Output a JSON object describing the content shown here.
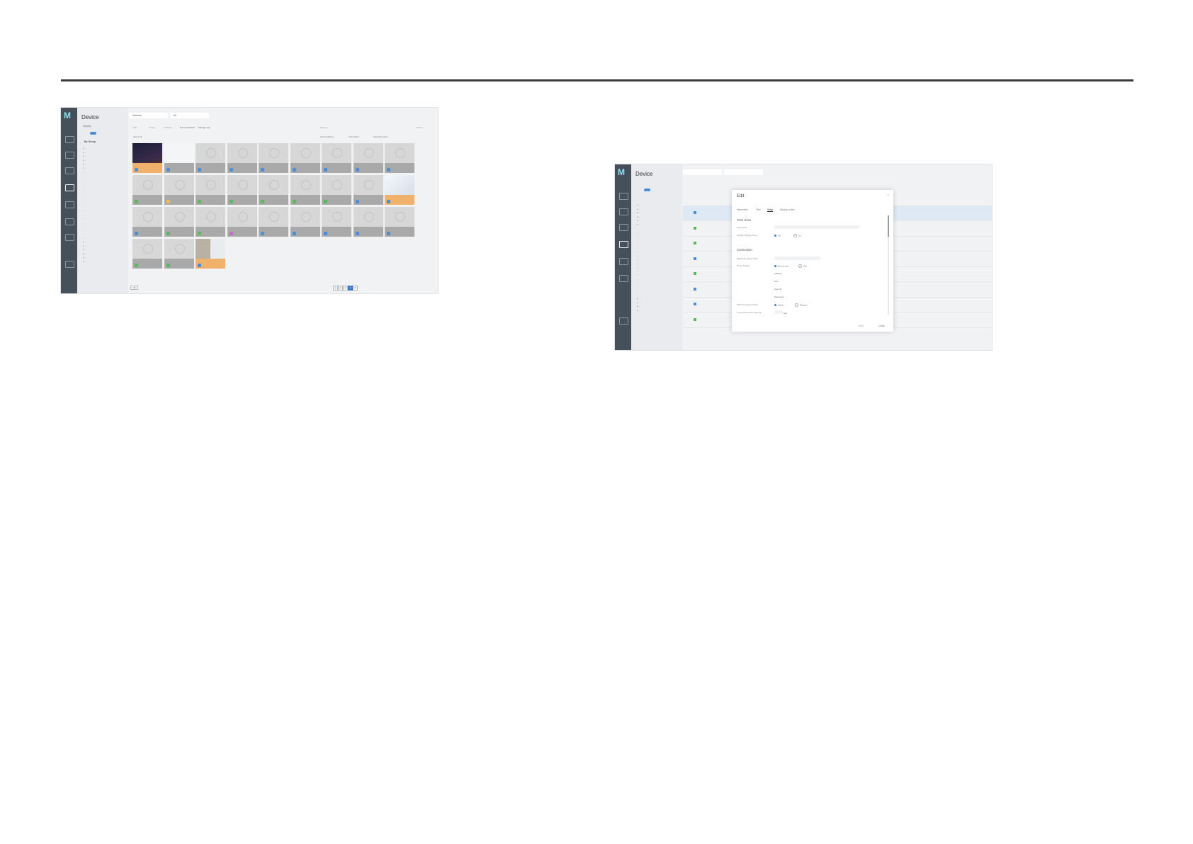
{
  "shot1": {
    "app_title": "Device",
    "sidebar": {
      "filter_label": "Display",
      "group_label": "By Group",
      "tree": [
        "▸ ...",
        "▸ ...",
        "▸ ...",
        "▸ ...",
        "▸ ...",
        "▾ ...",
        "  ...",
        "  ...",
        "  ...",
        "  ...",
        "  ...",
        "  ...",
        "  ...",
        "  ...",
        "  ...",
        "  ...",
        "  ...",
        "  ...",
        "  ...",
        "  ...",
        "  ...",
        "  ...",
        "  ...",
        "  ...",
        "▸ ...",
        "▸ ...",
        "▸ ...",
        "▸ ...",
        "▸ ...",
        "▸ ..."
      ]
    },
    "tabs": [
      "Network",
      "All"
    ],
    "toolbar": [
      "Edit",
      "Delete",
      "Publish",
      "Event Schedule",
      "Manage Tag",
      "Filter by",
      "Search"
    ],
    "subbar": {
      "left": "Select All",
      "items": [
        "Select Options",
        "Information",
        "Tag Information"
      ]
    },
    "tiles": [
      {
        "sel": true,
        "img": "dark",
        "st": "#4a8ed8"
      },
      {
        "sel": false,
        "img": "list",
        "st": "#4a8ed8"
      },
      {
        "sel": false,
        "st": "#4a8ed8"
      },
      {
        "sel": false,
        "st": "#4a8ed8"
      },
      {
        "sel": false,
        "st": "#4a8ed8"
      },
      {
        "sel": false,
        "st": "#4a8ed8"
      },
      {
        "sel": false,
        "st": "#4a8ed8"
      },
      {
        "sel": false,
        "st": "#4a8ed8"
      },
      {
        "sel": false,
        "st": "#4a8ed8"
      },
      {
        "sel": false,
        "st": "#5cb85c"
      },
      {
        "sel": false,
        "st": "#f0c040"
      },
      {
        "sel": false,
        "st": "#5cb85c"
      },
      {
        "sel": false,
        "st": "#5cb85c"
      },
      {
        "sel": false,
        "st": "#5cb85c"
      },
      {
        "sel": false,
        "st": "#5cb85c"
      },
      {
        "sel": false,
        "st": "#5cb85c"
      },
      {
        "sel": false,
        "st": "#4a8ed8"
      },
      {
        "sel": true,
        "img": "light",
        "st": "#4a8ed8"
      },
      {
        "sel": false,
        "st": "#4a8ed8"
      },
      {
        "sel": false,
        "st": "#5cb85c"
      },
      {
        "sel": false,
        "st": "#5cb85c"
      },
      {
        "sel": false,
        "st": "#c86ac8"
      },
      {
        "sel": false,
        "st": "#4a8ed8"
      },
      {
        "sel": false,
        "st": "#4a8ed8"
      },
      {
        "sel": false,
        "st": "#4a8ed8"
      },
      {
        "sel": false,
        "st": "#4a8ed8"
      },
      {
        "sel": false,
        "st": "#4a8ed8"
      },
      {
        "sel": false,
        "st": "#5cb85c"
      },
      {
        "sel": false,
        "st": "#5cb85c"
      },
      {
        "sel": true,
        "img": "photo",
        "st": "#4a8ed8"
      }
    ],
    "pager": {
      "per_page": "30",
      "pages": [
        "1",
        "2",
        "3",
        "4",
        "5"
      ],
      "current": "4"
    }
  },
  "shot2": {
    "app_title": "Device",
    "modal": {
      "title": "Edit",
      "close": "×",
      "tabs": [
        "Information",
        "Time",
        "Setup",
        "Display control"
      ],
      "active_tab": "Setup",
      "section_time_zone": "Time Zone",
      "label_time_zone": "Time Zone",
      "label_dst": "Daylight Saving Time",
      "dst_off": "Off",
      "dst_on": "On",
      "section_connection": "Connection",
      "label_magicinfo_server": "MagicInfo Server URL",
      "label_proxy": "Proxy Setting",
      "proxy_do_not_use": "Do not Use",
      "proxy_use": "Use",
      "label_address": "Address",
      "label_port": "Port",
      "label_user_id": "User ID",
      "label_password": "Password",
      "label_ftp_mode": "FTP Connection Mode",
      "ftp_active": "Active",
      "ftp_passive": "Passive",
      "label_conn_timer": "Connection Timer Interval",
      "timer_unit": "Sec",
      "btn_save": "Save",
      "btn_close": "Close"
    }
  }
}
